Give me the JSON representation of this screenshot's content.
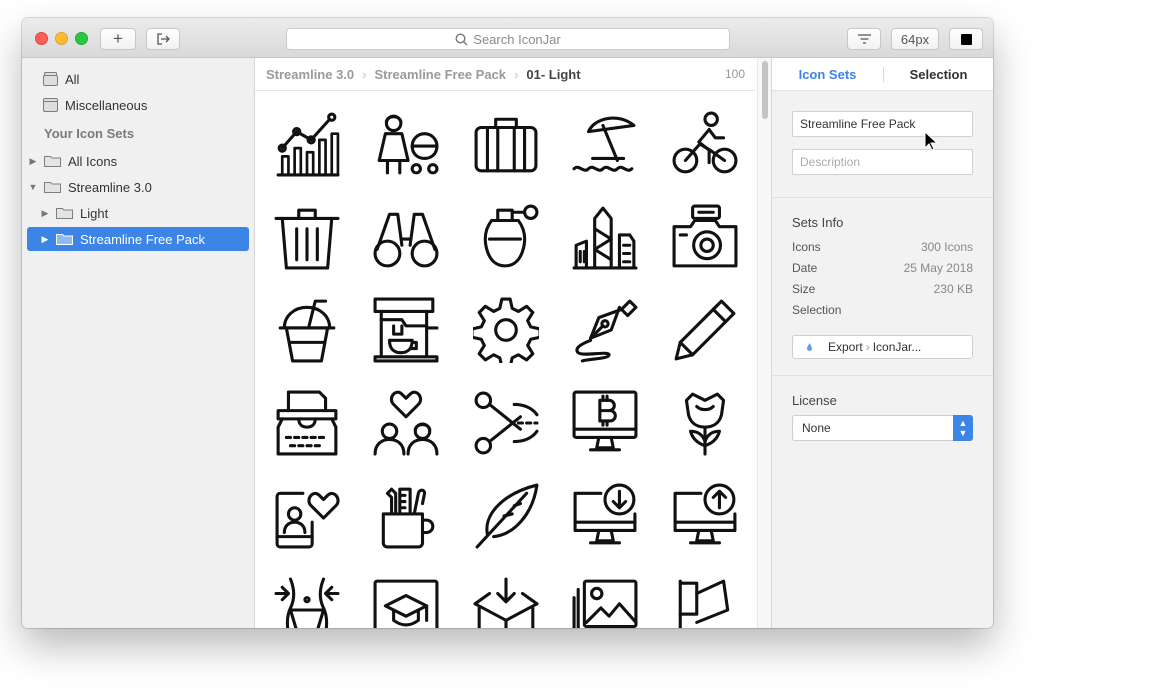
{
  "toolbar": {
    "add_label": "+",
    "search_placeholder": "Search IconJar",
    "size_label": "64px"
  },
  "sidebar": {
    "top_items": [
      {
        "label": "All"
      },
      {
        "label": "Miscellaneous"
      }
    ],
    "section_header": "Your Icon Sets",
    "tree": [
      {
        "label": "All Icons",
        "disclosure": "▶"
      },
      {
        "label": "Streamline 3.0",
        "disclosure": "▼"
      },
      {
        "label": "Light",
        "disclosure": "▶"
      },
      {
        "label": "Streamline Free Pack",
        "disclosure": "▶"
      }
    ]
  },
  "breadcrumb": {
    "items": [
      "Streamline 3.0",
      "Streamline Free Pack",
      "01- Light"
    ],
    "separator": "›",
    "count": "100"
  },
  "icons": [
    "line-chart-icon",
    "mother-stroller-icon",
    "briefcase-icon",
    "beach-umbrella-icon",
    "cyclist-icon",
    "trash-can-icon",
    "binoculars-icon",
    "perfume-bottle-icon",
    "city-buildings-icon",
    "camera-icon",
    "iced-drink-icon",
    "coffee-machine-icon",
    "gear-icon",
    "pen-nib-drawing-icon",
    "pen-icon",
    "typewriter-icon",
    "couple-heart-icon",
    "scissors-cut-icon",
    "bitcoin-monitor-icon",
    "rose-icon",
    "phone-profile-heart-icon",
    "pencil-cup-icon",
    "feather-quill-icon",
    "monitor-download-icon",
    "monitor-upload-icon",
    "waist-measure-icon",
    "graduation-frame-icon",
    "box-download-icon",
    "photo-stack-icon",
    "flag-icon"
  ],
  "inspector": {
    "tabs": [
      {
        "label": "Icon Sets"
      },
      {
        "label": "Selection"
      }
    ],
    "name_value": "Streamline Free Pack",
    "description_placeholder": "Description",
    "sets_info_title": "Sets Info",
    "info": [
      {
        "label": "Icons",
        "value": "300 Icons"
      },
      {
        "label": "Date",
        "value": "25 May 2018"
      },
      {
        "label": "Size",
        "value": "230 KB"
      },
      {
        "label": "Selection",
        "value": ""
      }
    ],
    "export_label": "Export",
    "export_target": "IconJar...",
    "license_title": "License",
    "license_value": "None"
  },
  "colors": {
    "accent": "#3d84e7",
    "close": "#fd5e57",
    "minimize": "#febc2e",
    "zoom": "#2ac840"
  }
}
